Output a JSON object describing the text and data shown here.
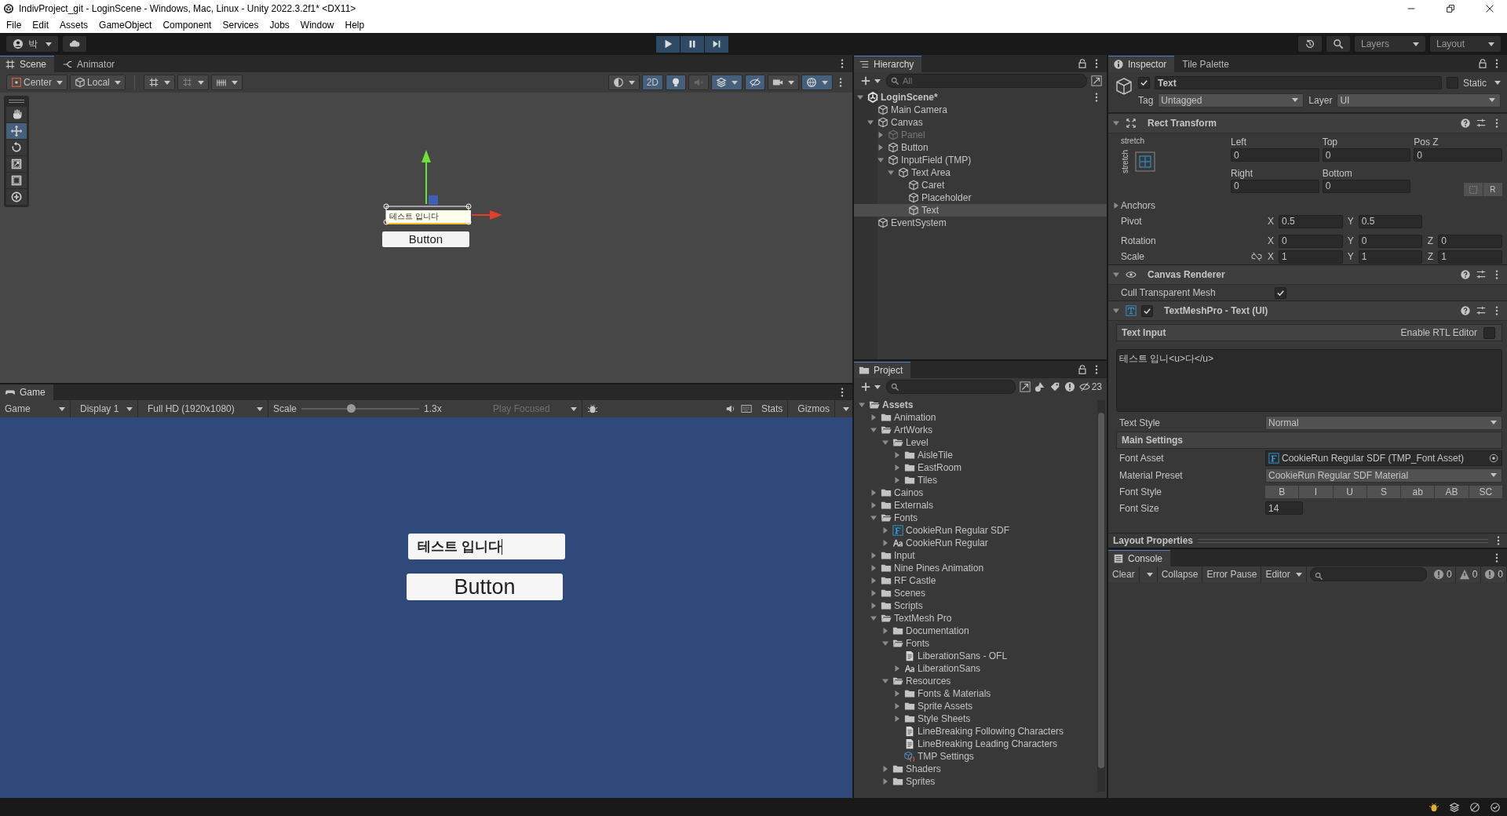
{
  "window": {
    "title": "IndivProject_git - LoginScene - Windows, Mac, Linux - Unity 2022.3.2f1* <DX11>"
  },
  "menu": [
    "File",
    "Edit",
    "Assets",
    "GameObject",
    "Component",
    "Services",
    "Jobs",
    "Window",
    "Help"
  ],
  "toolbar": {
    "account": "박",
    "layers": "Layers",
    "layout": "Layout"
  },
  "scene_panel": {
    "tabs": [
      {
        "label": "Scene",
        "selected": true
      },
      {
        "label": "Animator",
        "selected": false
      }
    ],
    "pivot_mode": "Center",
    "pivot_space": "Local",
    "mode_2d": {
      "label": "2D",
      "on": true
    },
    "tools": [
      {
        "kind": "hand",
        "selected": false
      },
      {
        "kind": "move",
        "selected": true
      },
      {
        "kind": "rotate",
        "selected": false
      },
      {
        "kind": "scale",
        "selected": false
      },
      {
        "kind": "rect",
        "selected": false
      },
      {
        "kind": "transform",
        "selected": false
      }
    ],
    "input_text": "테스트 입니다",
    "button": "Button"
  },
  "game_panel": {
    "tab": "Game",
    "view": "Game",
    "display": "Display 1",
    "resolution": "Full HD (1920x1080)",
    "scale_label": "Scale",
    "scale": {
      "level": 0.42
    },
    "scale_value": "1.3x",
    "play_mode": "Play Focused",
    "stats": "Stats",
    "gizmos": "Gizmos",
    "input_field": {
      "value": "테스트 입니다"
    },
    "button": "Button"
  },
  "hierarchy": {
    "title": "Hierarchy",
    "search_placeholder": "All",
    "items": [
      {
        "label": "LoginScene*",
        "kind": "scene",
        "expanded": true,
        "selected": false,
        "disabled": false,
        "children": [
          {
            "label": "Main Camera",
            "kind": "object",
            "selected": false,
            "disabled": false
          },
          {
            "label": "Canvas",
            "kind": "object",
            "expanded": true,
            "selected": false,
            "disabled": false,
            "children": [
              {
                "label": "Panel",
                "kind": "object",
                "expanded": false,
                "selected": false,
                "disabled": true
              },
              {
                "label": "Button",
                "kind": "object",
                "expanded": false,
                "selected": false,
                "disabled": false
              },
              {
                "label": "InputField (TMP)",
                "kind": "object",
                "expanded": true,
                "selected": false,
                "disabled": false,
                "children": [
                  {
                    "label": "Text Area",
                    "kind": "object",
                    "expanded": true,
                    "selected": false,
                    "disabled": false,
                    "children": [
                      {
                        "label": "Caret",
                        "kind": "object",
                        "selected": false,
                        "disabled": false
                      },
                      {
                        "label": "Placeholder",
                        "kind": "object",
                        "selected": false,
                        "disabled": false
                      },
                      {
                        "label": "Text",
                        "kind": "object",
                        "selected": true,
                        "disabled": false
                      }
                    ]
                  }
                ]
              }
            ]
          },
          {
            "label": "EventSystem",
            "kind": "object",
            "selected": false,
            "disabled": false
          }
        ]
      }
    ]
  },
  "project": {
    "title": "Project",
    "hidden_count": "23",
    "items": [
      {
        "label": "Assets",
        "kind": "folder",
        "expanded": true,
        "children": [
          {
            "label": "Animation",
            "kind": "folder",
            "expanded": false
          },
          {
            "label": "ArtWorks",
            "kind": "folder",
            "expanded": true,
            "children": [
              {
                "label": "Level",
                "kind": "folder",
                "expanded": true,
                "children": [
                  {
                    "label": "AisleTile",
                    "kind": "folder",
                    "expanded": false
                  },
                  {
                    "label": "EastRoom",
                    "kind": "folder",
                    "expanded": false
                  },
                  {
                    "label": "Tiles",
                    "kind": "folder",
                    "expanded": false
                  }
                ]
              }
            ]
          },
          {
            "label": "Cainos",
            "kind": "folder",
            "expanded": false
          },
          {
            "label": "Externals",
            "kind": "folder",
            "expanded": false
          },
          {
            "label": "Fonts",
            "kind": "folder",
            "expanded": true,
            "children": [
              {
                "label": "CookieRun Regular SDF",
                "kind": "font_asset",
                "expanded": false
              },
              {
                "label": "CookieRun Regular",
                "kind": "font",
                "expanded": false
              }
            ]
          },
          {
            "label": "Input",
            "kind": "folder",
            "expanded": false
          },
          {
            "label": "Nine Pines Animation",
            "kind": "folder",
            "expanded": false
          },
          {
            "label": "RF Castle",
            "kind": "folder",
            "expanded": false
          },
          {
            "label": "Scenes",
            "kind": "folder",
            "expanded": false
          },
          {
            "label": "Scripts",
            "kind": "folder",
            "expanded": false
          },
          {
            "label": "TextMesh Pro",
            "kind": "folder",
            "expanded": true,
            "children": [
              {
                "label": "Documentation",
                "kind": "folder",
                "expanded": false
              },
              {
                "label": "Fonts",
                "kind": "folder",
                "expanded": true,
                "children": [
                  {
                    "label": "LiberationSans - OFL",
                    "kind": "text"
                  },
                  {
                    "label": "LiberationSans",
                    "kind": "font",
                    "expanded": false
                  }
                ]
              },
              {
                "label": "Resources",
                "kind": "folder",
                "expanded": true,
                "children": [
                  {
                    "label": "Fonts & Materials",
                    "kind": "folder",
                    "expanded": false
                  },
                  {
                    "label": "Sprite Assets",
                    "kind": "folder",
                    "expanded": false
                  },
                  {
                    "label": "Style Sheets",
                    "kind": "folder",
                    "expanded": false
                  },
                  {
                    "label": "LineBreaking Following Characters",
                    "kind": "text"
                  },
                  {
                    "label": "LineBreaking Leading Characters",
                    "kind": "text"
                  },
                  {
                    "label": "TMP Settings",
                    "kind": "settings"
                  }
                ]
              },
              {
                "label": "Shaders",
                "kind": "folder",
                "expanded": false
              },
              {
                "label": "Sprites",
                "kind": "folder",
                "expanded": false
              }
            ]
          }
        ]
      }
    ]
  },
  "inspector": {
    "tabs": [
      {
        "label": "Inspector",
        "selected": true
      },
      {
        "label": "Tile Palette",
        "selected": false
      }
    ],
    "object": {
      "active": true,
      "name": "Text",
      "static_label": "Static",
      "static": false,
      "tag_label": "Tag",
      "tag": "Untagged",
      "layer_label": "Layer",
      "layer": "UI"
    },
    "rect_transform": {
      "title": "Rect Transform",
      "expanded": true,
      "anchor_h": "stretch",
      "anchor_v": "stretch",
      "fields": [
        {
          "label": "Left",
          "value": "0"
        },
        {
          "label": "Top",
          "value": "0"
        },
        {
          "label": "Pos Z",
          "value": "0"
        },
        {
          "label": "Right",
          "value": "0"
        },
        {
          "label": "Bottom",
          "value": "0"
        }
      ],
      "raw_button": "R",
      "anchors": {
        "label": "Anchors",
        "expanded": false
      },
      "rows": [
        {
          "label": "Pivot",
          "axes": [
            {
              "axis": "X",
              "value": "0.5"
            },
            {
              "axis": "Y",
              "value": "0.5"
            }
          ]
        },
        {
          "label": "Rotation",
          "axes": [
            {
              "axis": "X",
              "value": "0"
            },
            {
              "axis": "Y",
              "value": "0"
            },
            {
              "axis": "Z",
              "value": "0"
            }
          ]
        },
        {
          "label": "Scale",
          "axes": [
            {
              "axis": "X",
              "value": "1"
            },
            {
              "axis": "Y",
              "value": "1"
            },
            {
              "axis": "Z",
              "value": "1"
            }
          ]
        }
      ]
    },
    "canvas_renderer": {
      "title": "Canvas Renderer",
      "expanded": true,
      "cull_label": "Cull Transparent Mesh",
      "cull": true
    },
    "tmp": {
      "title": "TextMeshPro - Text (UI)",
      "expanded": true,
      "enabled": true,
      "text_input_label": "Text Input",
      "rtl_label": "Enable RTL Editor",
      "rtl": false,
      "text": "테스트 입니<u>다</u>",
      "text_style_label": "Text Style",
      "text_style": "Normal",
      "main_settings": "Main Settings",
      "font_asset_label": "Font Asset",
      "font_asset": "CookieRun Regular SDF (TMP_Font Asset)",
      "material_label": "Material Preset",
      "material": "CookieRun Regular SDF Material",
      "font_style_label": "Font Style",
      "font_styles": [
        {
          "label": "B",
          "selected": false
        },
        {
          "label": "I",
          "selected": false
        },
        {
          "label": "U",
          "selected": false
        },
        {
          "label": "S",
          "selected": false
        },
        {
          "label": "ab",
          "selected": false
        },
        {
          "label": "AB",
          "selected": false
        },
        {
          "label": "SC",
          "selected": false
        }
      ],
      "font_size_label": "Font Size",
      "font_size": "14"
    },
    "layout_properties": "Layout Properties"
  },
  "console": {
    "title": "Console",
    "clear": "Clear",
    "collapse": "Collapse",
    "error_pause": "Error Pause",
    "editor": "Editor",
    "counts": [
      {
        "kind": "info",
        "count": "0"
      },
      {
        "kind": "warning",
        "count": "0"
      },
      {
        "kind": "error",
        "count": "0"
      }
    ]
  }
}
